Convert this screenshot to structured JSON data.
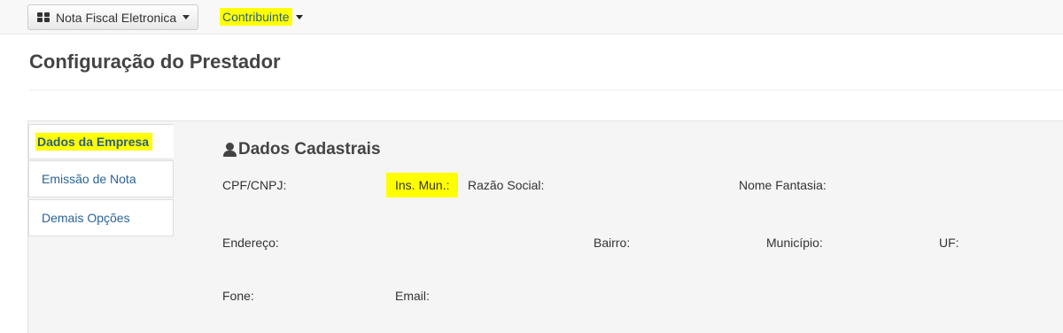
{
  "navbar": {
    "menu_button_label": "Nota Fiscal Eletronica",
    "contrib_label": "Contribuinte"
  },
  "page": {
    "title": "Configuração do Prestador"
  },
  "tabs": [
    {
      "label": "Dados da Empresa",
      "active": true
    },
    {
      "label": "Emissão de Nota",
      "active": false
    },
    {
      "label": "Demais Opções",
      "active": false
    }
  ],
  "section": {
    "title": "Dados Cadastrais"
  },
  "fields": {
    "cpf_cnpj": "CPF/CNPJ:",
    "ins_mun": "Ins. Mun.:",
    "razao_social": "Razão Social:",
    "nome_fantasia": "Nome Fantasia:",
    "endereco": "Endereço:",
    "bairro": "Bairro:",
    "municipio": "Município:",
    "uf": "UF:",
    "fone": "Fone:",
    "email": "Email:"
  },
  "colors": {
    "highlight": "#ffff00",
    "link": "#2a6496",
    "panel_bg": "#f5f5f5"
  },
  "icons": {
    "menu_icon": "grid-icon",
    "section_icon": "user-icon",
    "dropdown_icon": "caret-down-icon"
  }
}
